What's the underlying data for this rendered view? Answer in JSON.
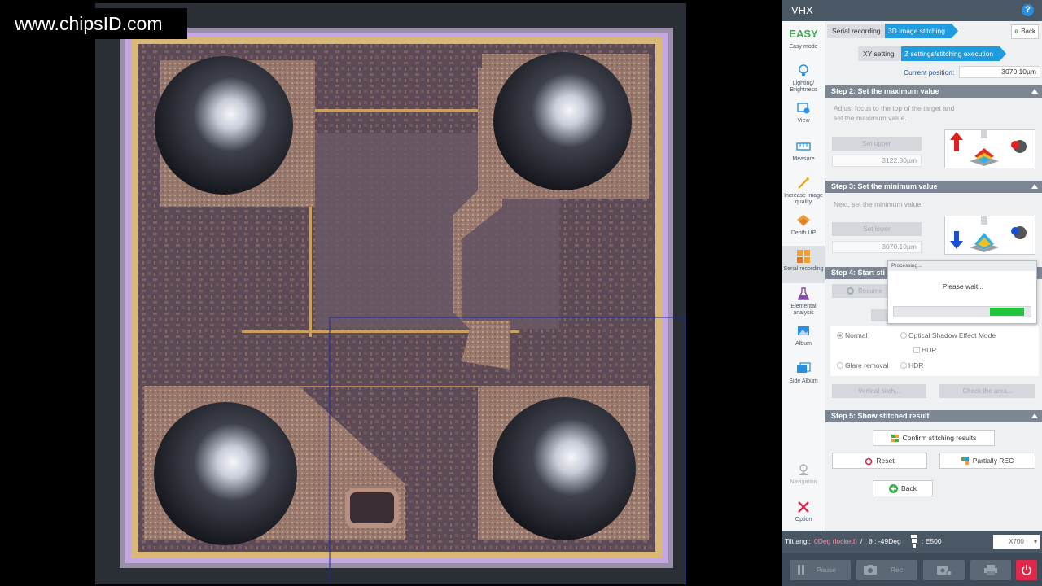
{
  "watermark": "www.chipsID.com",
  "app": {
    "title": "VHX"
  },
  "sidebar": {
    "mode_logo": "EASY",
    "items": [
      {
        "label": "Easy mode",
        "icon": "easy-mode-icon"
      },
      {
        "label": "Lighting/ Brightness",
        "icon": "bulb-icon"
      },
      {
        "label": "View",
        "icon": "view-icon"
      },
      {
        "label": "Measure",
        "icon": "ruler-icon"
      },
      {
        "label": "Increase image quality",
        "icon": "wand-icon"
      },
      {
        "label": "Depth UP",
        "icon": "layers-icon"
      },
      {
        "label": "Serial recording",
        "icon": "grid-icon"
      },
      {
        "label": "Elemental analysis",
        "icon": "flask-icon"
      },
      {
        "label": "Album",
        "icon": "album-icon"
      },
      {
        "label": "Side Album",
        "icon": "side-album-icon"
      },
      {
        "label": "Navigation",
        "icon": "navigation-icon"
      },
      {
        "label": "Option",
        "icon": "tools-icon"
      }
    ]
  },
  "breadcrumb": {
    "level1": [
      "Serial recording",
      "3D image stitching"
    ],
    "level2": [
      "XY setting",
      "Z settings/stitching execution"
    ],
    "back_label": "Back"
  },
  "current_position": {
    "label": "Current position:",
    "value": "3070.10µm"
  },
  "step2": {
    "title": "Step 2: Set the maximum value",
    "description": "Adjust focus to the top of the target and set the maximum value.",
    "button": "Set upper",
    "value": "3122.80µm"
  },
  "step3": {
    "title": "Step 3: Set the minimum value",
    "description": "Next, set the minimum value.",
    "button": "Set lower",
    "value": "3070.10µm"
  },
  "step4": {
    "title": "Step 4: Start sti",
    "resume_label": "Resume",
    "options": {
      "normal": "Normal",
      "optical_shadow": "Optical Shadow Effect Mode",
      "hdr_check": "HDR",
      "glare_removal": "Glare removal",
      "hdr_radio": "HDR"
    },
    "vertical_pitch": "Vertical pitch...",
    "check_area": "Check the area..."
  },
  "step5": {
    "title": "Step 5: Show stitched result",
    "confirm": "Confirm stitching results",
    "reset": "Reset",
    "partially_rec": "Partially REC",
    "back": "Back"
  },
  "dialog": {
    "title": "Processing...",
    "message": "Please wait...",
    "progress": 0.27
  },
  "status": {
    "tilt_label": "Tilt angl:",
    "tilt_value": "0Deg (locked)",
    "separator": "/",
    "theta": "θ : -49Deg",
    "lens": ": E500",
    "zoom": "X700"
  },
  "toolbar": {
    "pause": "Pause",
    "rec": "Rec"
  },
  "colors": {
    "accent_blue": "#1f9be0",
    "progress_green": "#22c43e",
    "power_red": "#e0294a",
    "easy_green": "#3bb14a"
  }
}
